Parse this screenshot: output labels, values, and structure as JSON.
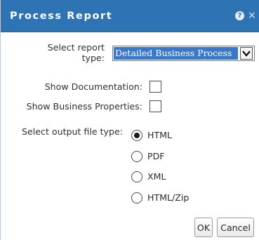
{
  "dialog": {
    "title": "Process Report",
    "help_icon_glyph": "?",
    "close_icon_glyph": "×"
  },
  "form": {
    "report_type_label_line1": "Select report",
    "report_type_label_line2": "type:",
    "report_type_selected": "Detailed Business Process",
    "show_documentation_label": "Show Documentation:",
    "show_documentation_checked": false,
    "show_business_properties_label": "Show Business Properties:",
    "show_business_properties_checked": false,
    "output_type_label": "Select output file type:",
    "output_options": [
      {
        "label": "HTML",
        "checked": true
      },
      {
        "label": "PDF",
        "checked": false
      },
      {
        "label": "XML",
        "checked": false
      },
      {
        "label": "HTML/Zip",
        "checked": false
      }
    ]
  },
  "buttons": {
    "ok_label": "OK",
    "cancel_label": "Cancel"
  },
  "colors": {
    "titlebar": "#2e73b4",
    "selection": "#3b78c8"
  }
}
